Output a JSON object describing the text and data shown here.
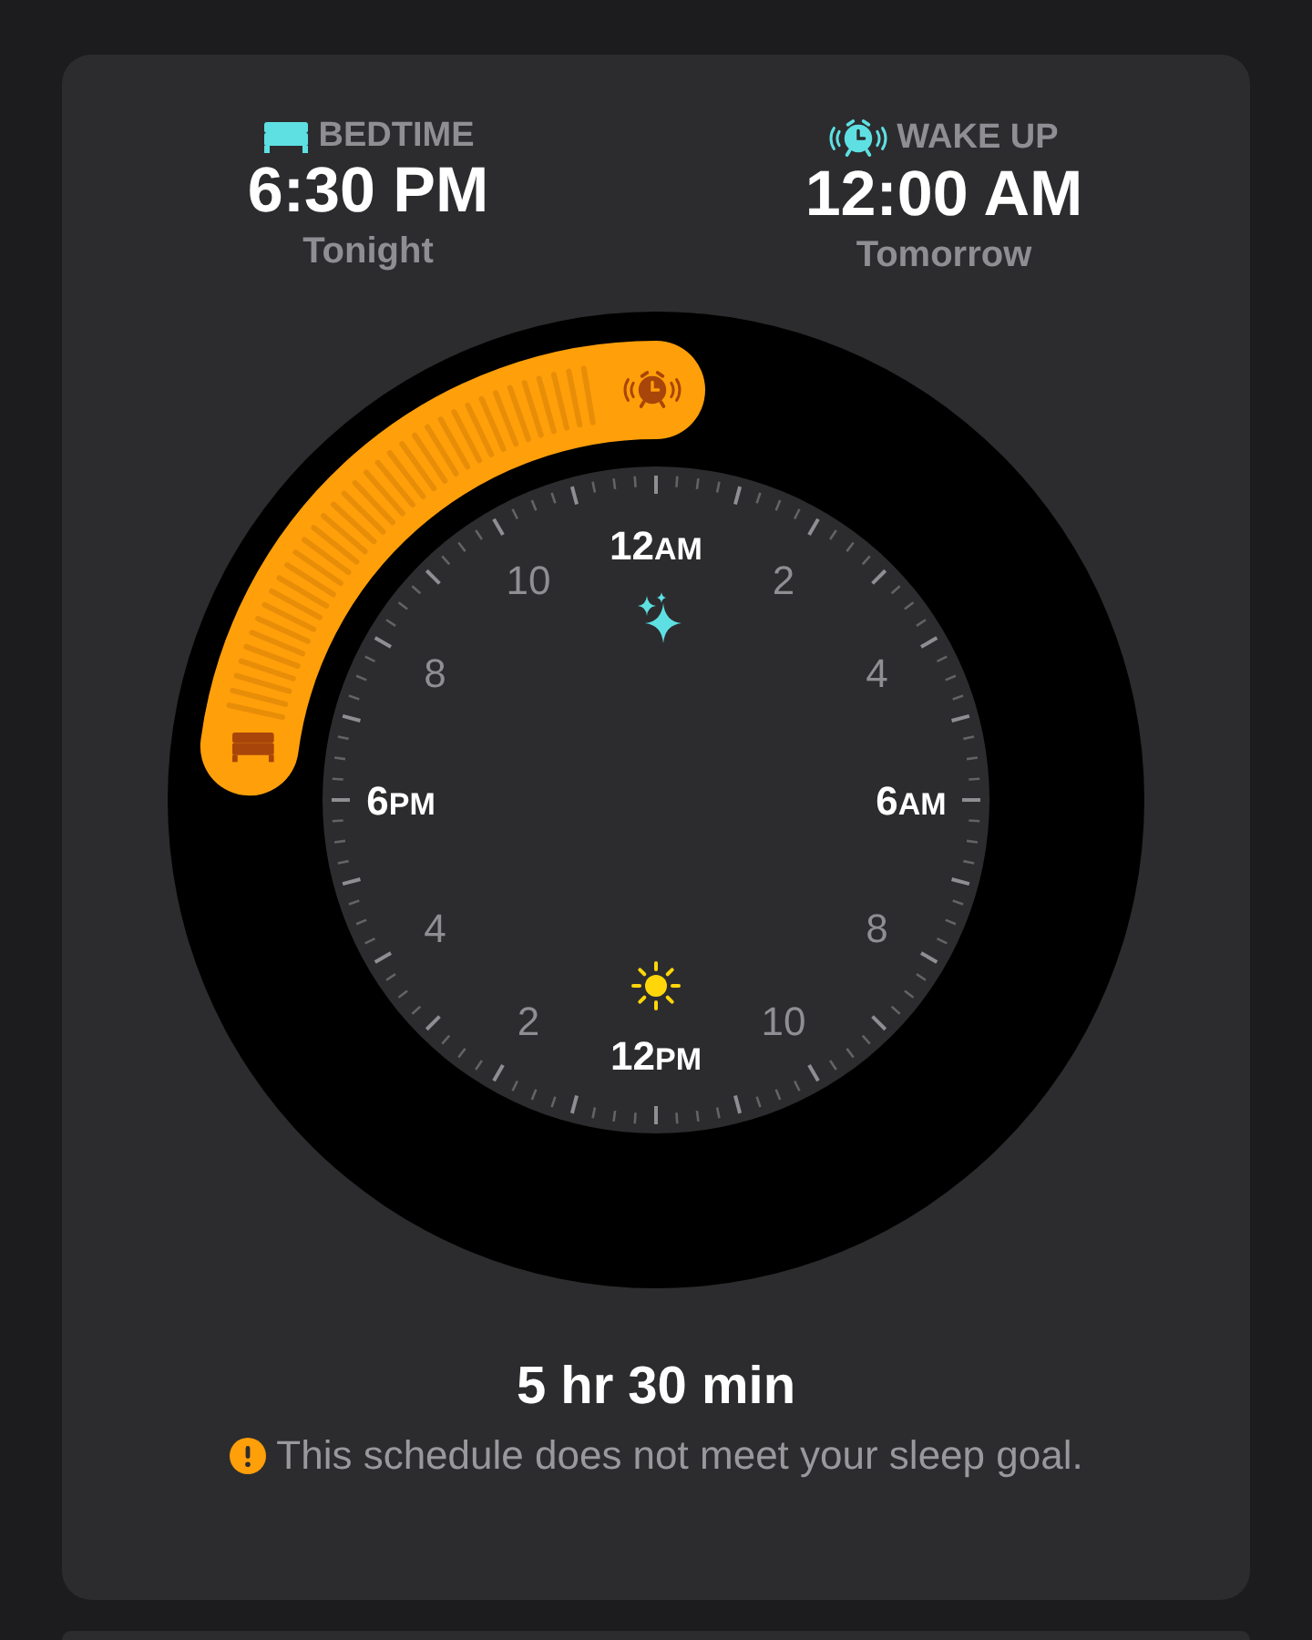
{
  "bedtime": {
    "label": "BEDTIME",
    "time": "6:30 PM",
    "day": "Tonight"
  },
  "wake_up": {
    "label": "WAKE UP",
    "time": "12:00 AM",
    "day": "Tomorrow"
  },
  "clock": {
    "hour_labels": [
      {
        "number": "12",
        "suffix": "AM",
        "major": true
      },
      {
        "number": "2",
        "major": false
      },
      {
        "number": "4",
        "major": false
      },
      {
        "number": "6",
        "suffix": "AM",
        "major": true
      },
      {
        "number": "8",
        "major": false
      },
      {
        "number": "10",
        "major": false
      },
      {
        "number": "12",
        "suffix": "PM",
        "major": true
      },
      {
        "number": "2",
        "major": false
      },
      {
        "number": "4",
        "major": false
      },
      {
        "number": "6",
        "suffix": "PM",
        "major": true
      },
      {
        "number": "8",
        "major": false
      },
      {
        "number": "10",
        "major": false
      }
    ]
  },
  "duration": "5 hr 30 min",
  "warning": "This schedule does not meet your sleep goal."
}
